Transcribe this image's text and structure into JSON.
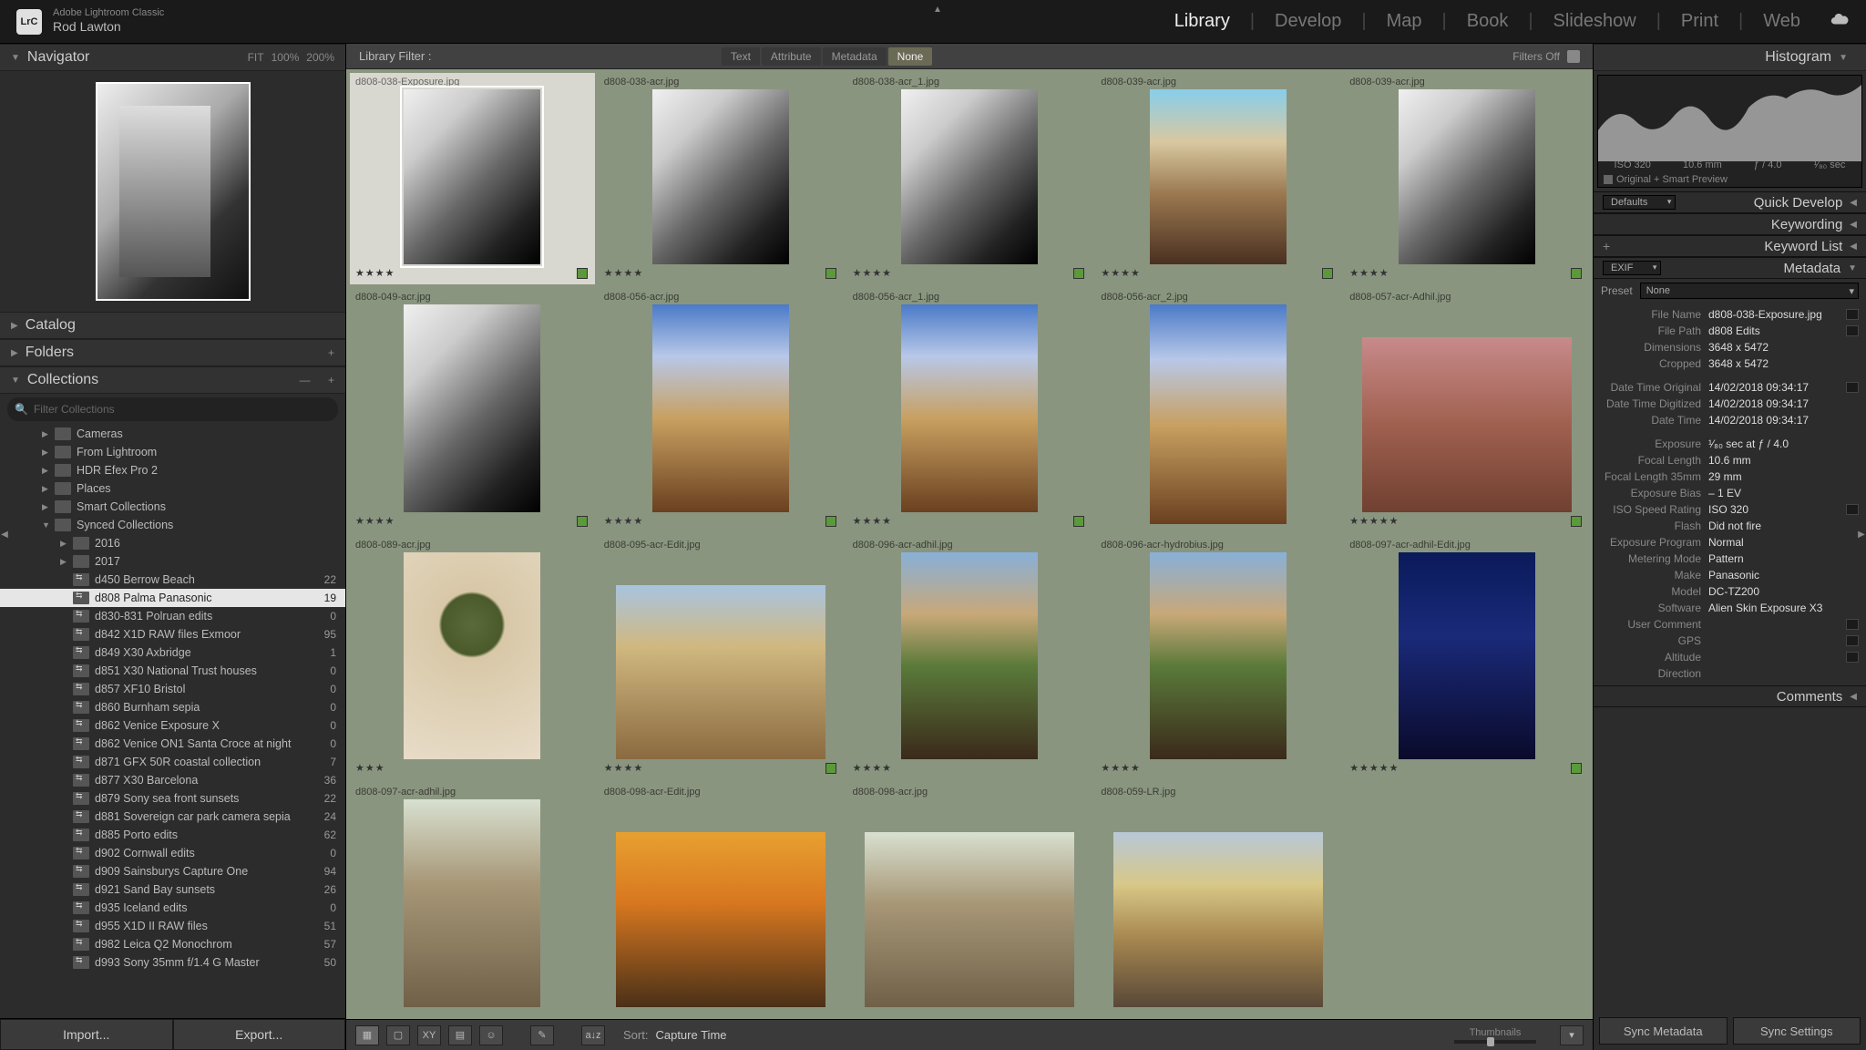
{
  "app": {
    "name": "Adobe Lightroom Classic",
    "user": "Rod Lawton",
    "logo": "LrC"
  },
  "modules": [
    "Library",
    "Develop",
    "Map",
    "Book",
    "Slideshow",
    "Print",
    "Web"
  ],
  "active_module": "Library",
  "navigator": {
    "title": "Navigator",
    "zoom": [
      "FIT",
      "100%",
      "200%"
    ]
  },
  "catalog_title": "Catalog",
  "folders_title": "Folders",
  "collections_title": "Collections",
  "collections_filter_placeholder": "Filter Collections",
  "collections": [
    {
      "lvl": 0,
      "name": "Cameras",
      "cnt": "",
      "arrow": "▶",
      "sync": false
    },
    {
      "lvl": 0,
      "name": "From Lightroom",
      "cnt": "",
      "arrow": "▶",
      "sync": false
    },
    {
      "lvl": 0,
      "name": "HDR Efex Pro 2",
      "cnt": "",
      "arrow": "▶",
      "sync": false
    },
    {
      "lvl": 0,
      "name": "Places",
      "cnt": "",
      "arrow": "▶",
      "sync": false
    },
    {
      "lvl": 0,
      "name": "Smart Collections",
      "cnt": "",
      "arrow": "▶",
      "sync": false
    },
    {
      "lvl": 0,
      "name": "Synced Collections",
      "cnt": "",
      "arrow": "▼",
      "sync": false
    },
    {
      "lvl": 1,
      "name": "2016",
      "cnt": "",
      "arrow": "▶",
      "sync": false
    },
    {
      "lvl": 1,
      "name": "2017",
      "cnt": "",
      "arrow": "▶",
      "sync": false
    },
    {
      "lvl": 1,
      "name": "d450 Berrow Beach",
      "cnt": "22",
      "arrow": "",
      "sync": true
    },
    {
      "lvl": 1,
      "name": "d808 Palma Panasonic",
      "cnt": "19",
      "arrow": "",
      "sync": true,
      "selected": true
    },
    {
      "lvl": 1,
      "name": "d830-831 Polruan edits",
      "cnt": "0",
      "arrow": "",
      "sync": true
    },
    {
      "lvl": 1,
      "name": "d842 X1D RAW files Exmoor",
      "cnt": "95",
      "arrow": "",
      "sync": true
    },
    {
      "lvl": 1,
      "name": "d849 X30 Axbridge",
      "cnt": "1",
      "arrow": "",
      "sync": true
    },
    {
      "lvl": 1,
      "name": "d851 X30 National Trust houses",
      "cnt": "0",
      "arrow": "",
      "sync": true
    },
    {
      "lvl": 1,
      "name": "d857 XF10 Bristol",
      "cnt": "0",
      "arrow": "",
      "sync": true
    },
    {
      "lvl": 1,
      "name": "d860 Burnham sepia",
      "cnt": "0",
      "arrow": "",
      "sync": true
    },
    {
      "lvl": 1,
      "name": "d862 Venice Exposure X",
      "cnt": "0",
      "arrow": "",
      "sync": true
    },
    {
      "lvl": 1,
      "name": "d862 Venice ON1 Santa Croce at night",
      "cnt": "0",
      "arrow": "",
      "sync": true
    },
    {
      "lvl": 1,
      "name": "d871 GFX 50R coastal collection",
      "cnt": "7",
      "arrow": "",
      "sync": true
    },
    {
      "lvl": 1,
      "name": "d877 X30 Barcelona",
      "cnt": "36",
      "arrow": "",
      "sync": true
    },
    {
      "lvl": 1,
      "name": "d879 Sony sea front sunsets",
      "cnt": "22",
      "arrow": "",
      "sync": true
    },
    {
      "lvl": 1,
      "name": "d881 Sovereign car park camera sepia",
      "cnt": "24",
      "arrow": "",
      "sync": true
    },
    {
      "lvl": 1,
      "name": "d885 Porto edits",
      "cnt": "62",
      "arrow": "",
      "sync": true
    },
    {
      "lvl": 1,
      "name": "d902 Cornwall edits",
      "cnt": "0",
      "arrow": "",
      "sync": true
    },
    {
      "lvl": 1,
      "name": "d909 Sainsburys Capture One",
      "cnt": "94",
      "arrow": "",
      "sync": true
    },
    {
      "lvl": 1,
      "name": "d921 Sand Bay sunsets",
      "cnt": "26",
      "arrow": "",
      "sync": true
    },
    {
      "lvl": 1,
      "name": "d935 Iceland edits",
      "cnt": "0",
      "arrow": "",
      "sync": true
    },
    {
      "lvl": 1,
      "name": "d955 X1D II RAW files",
      "cnt": "51",
      "arrow": "",
      "sync": true
    },
    {
      "lvl": 1,
      "name": "d982 Leica Q2 Monochrom",
      "cnt": "57",
      "arrow": "",
      "sync": true
    },
    {
      "lvl": 1,
      "name": "d993 Sony 35mm f/1.4 G Master",
      "cnt": "50",
      "arrow": "",
      "sync": true
    }
  ],
  "import_btn": "Import...",
  "export_btn": "Export...",
  "library_filter": "Library Filter :",
  "filter_tabs": [
    "Text",
    "Attribute",
    "Metadata",
    "None"
  ],
  "filters_off": "Filters Off",
  "thumbs": [
    {
      "fn": "d808-038-Exposure.jpg",
      "cls": "bw",
      "shape": "portrait",
      "rating": "★★★★",
      "sel": true,
      "badge": true
    },
    {
      "fn": "d808-038-acr.jpg",
      "cls": "bw",
      "shape": "portrait",
      "rating": "★★★★",
      "badge": true
    },
    {
      "fn": "d808-038-acr_1.jpg",
      "cls": "bw",
      "shape": "portrait",
      "rating": "★★★★",
      "badge": true
    },
    {
      "fn": "d808-039-acr.jpg",
      "cls": "street",
      "shape": "portrait",
      "rating": "★★★★",
      "badge": true
    },
    {
      "fn": "d808-039-acr.jpg",
      "cls": "bw",
      "shape": "portrait",
      "rating": "★★★★",
      "badge": true
    },
    {
      "fn": "d808-049-acr.jpg",
      "cls": "bw",
      "shape": "portrait",
      "rating": "★★★★",
      "badge": true
    },
    {
      "fn": "d808-056-acr.jpg",
      "cls": "sky",
      "shape": "portrait",
      "rating": "★★★★",
      "badge": true
    },
    {
      "fn": "d808-056-acr_1.jpg",
      "cls": "sky",
      "shape": "portrait",
      "rating": "★★★★",
      "badge": true
    },
    {
      "fn": "d808-056-acr_2.jpg",
      "cls": "sky",
      "shape": "portrait",
      "rating": "",
      "badge": false
    },
    {
      "fn": "d808-057-acr-Adhil.jpg",
      "cls": "pink",
      "shape": "landscape",
      "rating": "★★★★★",
      "badge": true
    },
    {
      "fn": "d808-089-acr.jpg",
      "cls": "plant",
      "shape": "portrait",
      "rating": "★★★",
      "badge": false
    },
    {
      "fn": "d808-095-acr-Edit.jpg",
      "cls": "building",
      "shape": "landscape",
      "rating": "★★★★",
      "badge": true
    },
    {
      "fn": "d808-096-acr-adhil.jpg",
      "cls": "cathedral",
      "shape": "portrait",
      "rating": "★★★★",
      "badge": false
    },
    {
      "fn": "d808-096-acr-hydrobius.jpg",
      "cls": "cathedral",
      "shape": "portrait",
      "rating": "★★★★",
      "badge": false
    },
    {
      "fn": "d808-097-acr-adhil-Edit.jpg",
      "cls": "night",
      "shape": "portrait",
      "rating": "★★★★★",
      "badge": true
    },
    {
      "fn": "d808-097-acr-adhil.jpg",
      "cls": "fort",
      "shape": "portrait",
      "rating": "",
      "badge": false
    },
    {
      "fn": "d808-098-acr-Edit.jpg",
      "cls": "sunset",
      "shape": "landscape",
      "rating": "",
      "badge": false
    },
    {
      "fn": "d808-098-acr.jpg",
      "cls": "fort",
      "shape": "landscape",
      "rating": "",
      "badge": false
    },
    {
      "fn": "d808-059-LR.jpg",
      "cls": "plaza",
      "shape": "landscape",
      "rating": "",
      "badge": false
    }
  ],
  "toolbar": {
    "sort_lbl": "Sort:",
    "sort_val": "Capture Time",
    "thumbs_lbl": "Thumbnails"
  },
  "histogram_title": "Histogram",
  "hist_info": {
    "iso": "ISO 320",
    "focal": "10.6 mm",
    "aperture": "ƒ / 4.0",
    "shutter": "¹⁄₈₀ sec"
  },
  "hist_sub": "Original + Smart Preview",
  "right_panels": {
    "defaults": "Defaults",
    "quick": "Quick Develop",
    "keywording": "Keywording",
    "keylist": "Keyword List",
    "exif": "EXIF",
    "metadata": "Metadata",
    "comments": "Comments"
  },
  "preset": {
    "lbl": "Preset",
    "val": "None"
  },
  "metadata": [
    {
      "lbl": "File Name",
      "val": "d808-038-Exposure.jpg",
      "box": true
    },
    {
      "lbl": "File Path",
      "val": "d808 Edits",
      "box": true
    },
    {
      "lbl": "Dimensions",
      "val": "3648 x 5472"
    },
    {
      "lbl": "Cropped",
      "val": "3648 x 5472"
    },
    {
      "gap": true
    },
    {
      "lbl": "Date Time Original",
      "val": "14/02/2018 09:34:17",
      "box": true
    },
    {
      "lbl": "Date Time Digitized",
      "val": "14/02/2018 09:34:17"
    },
    {
      "lbl": "Date Time",
      "val": "14/02/2018 09:34:17"
    },
    {
      "gap": true
    },
    {
      "lbl": "Exposure",
      "val": "¹⁄₈₀ sec at ƒ / 4.0"
    },
    {
      "lbl": "Focal Length",
      "val": "10.6 mm"
    },
    {
      "lbl": "Focal Length 35mm",
      "val": "29 mm"
    },
    {
      "lbl": "Exposure Bias",
      "val": "– 1 EV"
    },
    {
      "lbl": "ISO Speed Rating",
      "val": "ISO 320",
      "box": true
    },
    {
      "lbl": "Flash",
      "val": "Did not fire"
    },
    {
      "lbl": "Exposure Program",
      "val": "Normal"
    },
    {
      "lbl": "Metering Mode",
      "val": "Pattern"
    },
    {
      "lbl": "Make",
      "val": "Panasonic"
    },
    {
      "lbl": "Model",
      "val": "DC-TZ200"
    },
    {
      "lbl": "Software",
      "val": "Alien Skin Exposure X3"
    },
    {
      "lbl": "User Comment",
      "val": "",
      "box": true
    },
    {
      "lbl": "GPS",
      "val": "",
      "box": true
    },
    {
      "lbl": "Altitude",
      "val": "",
      "box": true
    },
    {
      "lbl": "Direction",
      "val": ""
    }
  ],
  "sync_meta": "Sync Metadata",
  "sync_settings": "Sync Settings"
}
